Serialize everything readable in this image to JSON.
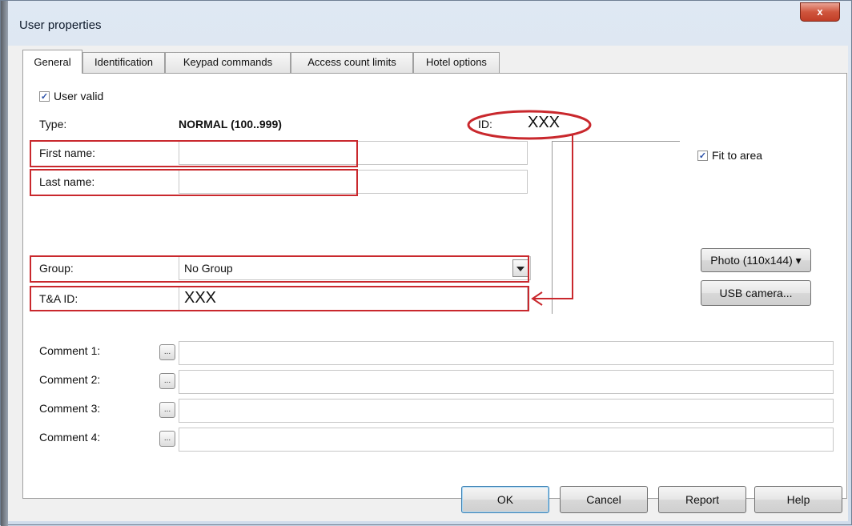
{
  "window": {
    "title": "User properties",
    "close_glyph": "x"
  },
  "tabs": [
    "General",
    "Identification",
    "Keypad commands",
    "Access count limits",
    "Hotel options"
  ],
  "general": {
    "user_valid": {
      "label": "User valid",
      "checked": true
    },
    "type": {
      "label": "Type:",
      "value": "NORMAL (100..999)"
    },
    "id": {
      "label": "ID:",
      "value": "XXX"
    },
    "first_name": {
      "label": "First name:",
      "value": ""
    },
    "last_name": {
      "label": "Last name:",
      "value": ""
    },
    "group": {
      "label": "Group:",
      "value": "No Group"
    },
    "ta_id": {
      "label": "T&A ID:",
      "value": "XXX"
    },
    "fit_to_area": {
      "label": "Fit to area",
      "checked": true
    },
    "photo_button": "Photo (110x144) ▾",
    "usb_camera_button": "USB camera...",
    "comments": [
      {
        "label": "Comment 1:",
        "value": ""
      },
      {
        "label": "Comment 2:",
        "value": ""
      },
      {
        "label": "Comment 3:",
        "value": ""
      },
      {
        "label": "Comment 4:",
        "value": ""
      }
    ],
    "ellipsis": "..."
  },
  "footer": {
    "ok": "OK",
    "cancel": "Cancel",
    "report": "Report",
    "help": "Help"
  },
  "colors": {
    "annotation_red": "#c9282d",
    "window_frame": "#cfdceb"
  },
  "icons": {
    "checkbox": "checkmark-icon",
    "dropdown": "chevron-down-icon",
    "close": "close-icon"
  }
}
